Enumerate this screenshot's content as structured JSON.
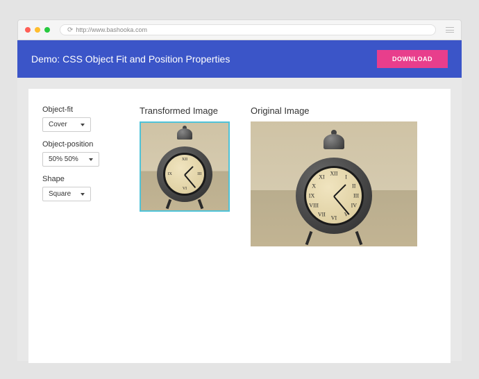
{
  "browser": {
    "url": "http://www.bashooka.com"
  },
  "header": {
    "title": "Demo: CSS Object Fit and Position Properties",
    "download_label": "DOWNLOAD"
  },
  "sidebar": {
    "object_fit": {
      "label": "Object-fit",
      "value": "Cover"
    },
    "object_position": {
      "label": "Object-position",
      "value": "50% 50%"
    },
    "shape": {
      "label": "Shape",
      "value": "Square"
    }
  },
  "images": {
    "transformed_title": "Transformed Image",
    "original_title": "Original Image"
  }
}
